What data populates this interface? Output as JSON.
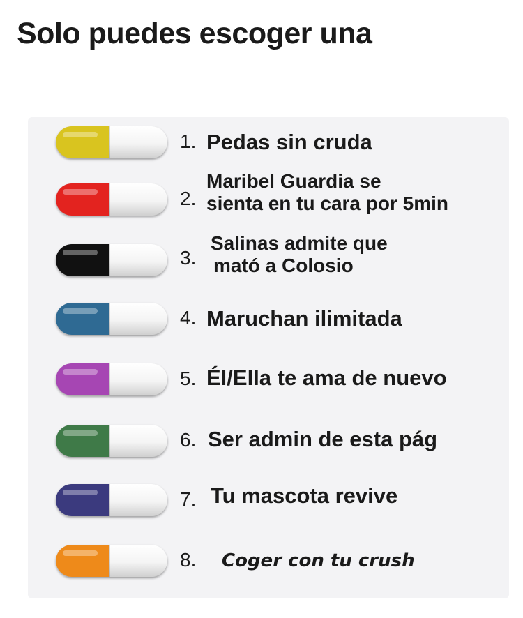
{
  "title": "Solo puedes escoger una",
  "options": [
    {
      "number": "1.",
      "text": "Pedas sin cruda",
      "color": "#d9c41f"
    },
    {
      "number": "2.",
      "text_line1": "Maribel Guardia se",
      "text_line2": "sienta en tu cara por 5min",
      "color": "#e3231f"
    },
    {
      "number": "3.",
      "text_line1": "Salinas admite que",
      "text_line2": "mató a Colosio",
      "color": "#111111"
    },
    {
      "number": "4.",
      "text": "Maruchan ilimitada",
      "color": "#2f6a93"
    },
    {
      "number": "5.",
      "text": "Él/Ella te ama de nuevo",
      "color": "#a646b3"
    },
    {
      "number": "6.",
      "text": "Ser admin de esta pág",
      "color": "#3f7a48"
    },
    {
      "number": "7.",
      "text": "Tu mascota revive",
      "color": "#3b3a7e"
    },
    {
      "number": "8.",
      "text": "Coger con tu crush",
      "color": "#ee8a1a"
    }
  ]
}
